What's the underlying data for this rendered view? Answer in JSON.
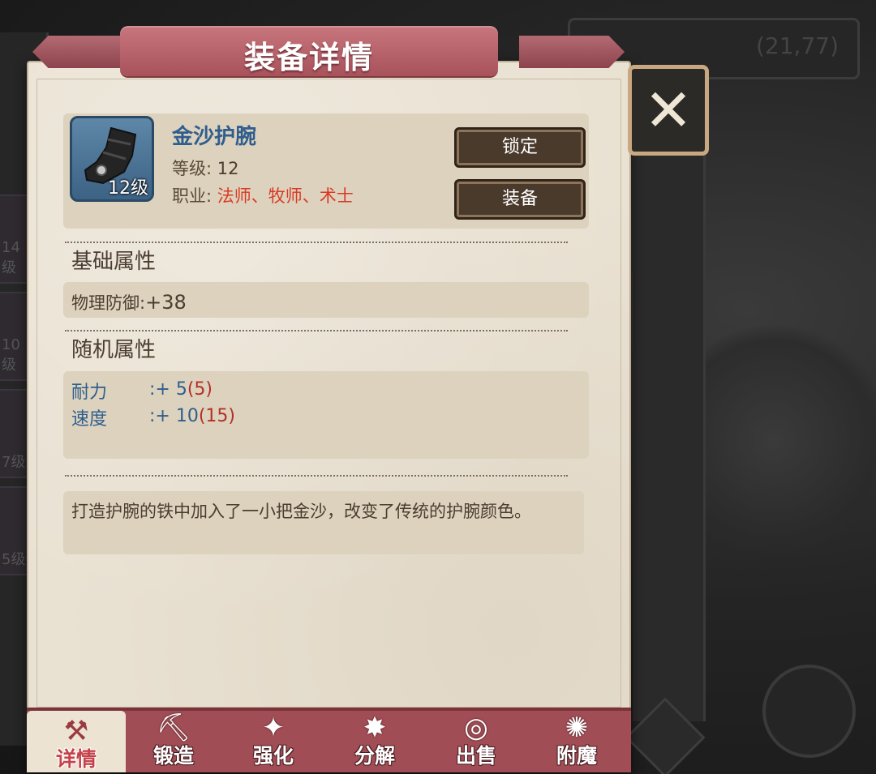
{
  "dialog": {
    "title": "装备详情",
    "close_icon": "close-icon"
  },
  "background": {
    "coordinates": "(21,77)",
    "slot_levels": [
      "14级",
      "10级",
      "7级",
      "5级"
    ]
  },
  "item": {
    "name": "金沙护腕",
    "icon": "bracer-icon",
    "level_badge": "12级",
    "level_label": "等级:",
    "level_value": "12",
    "class_label": "职业:",
    "class_value": "法师、牧师、术士"
  },
  "actions": {
    "lock_label": "锁定",
    "equip_label": "装备"
  },
  "basic_attributes": {
    "title": "基础属性",
    "stats": [
      {
        "label": "物理防御:",
        "value": "+38"
      }
    ]
  },
  "random_attributes": {
    "title": "随机属性",
    "stats": [
      {
        "label": "耐力",
        "prefix": ":+ ",
        "value": "5",
        "max": "(5)"
      },
      {
        "label": "速度",
        "prefix": ":+ ",
        "value": "10",
        "max": "(15)"
      }
    ]
  },
  "description": "打造护腕的铁中加入了一小把金沙，改变了传统的护腕颜色。",
  "tabs": [
    {
      "label": "详情",
      "icon": "hammer-icon",
      "active": true
    },
    {
      "label": "锻造",
      "icon": "anvil-icon",
      "active": false
    },
    {
      "label": "强化",
      "icon": "sparkle-icon",
      "active": false
    },
    {
      "label": "分解",
      "icon": "burst-icon",
      "active": false
    },
    {
      "label": "出售",
      "icon": "coins-icon",
      "active": false
    },
    {
      "label": "附魔",
      "icon": "enchant-icon",
      "active": false
    }
  ],
  "colors": {
    "accent": "#a04d55",
    "name_blue": "#2f5e8e",
    "class_red": "#d83a25",
    "max_red": "#b33029",
    "panel_bg": "#e9e1d2"
  }
}
